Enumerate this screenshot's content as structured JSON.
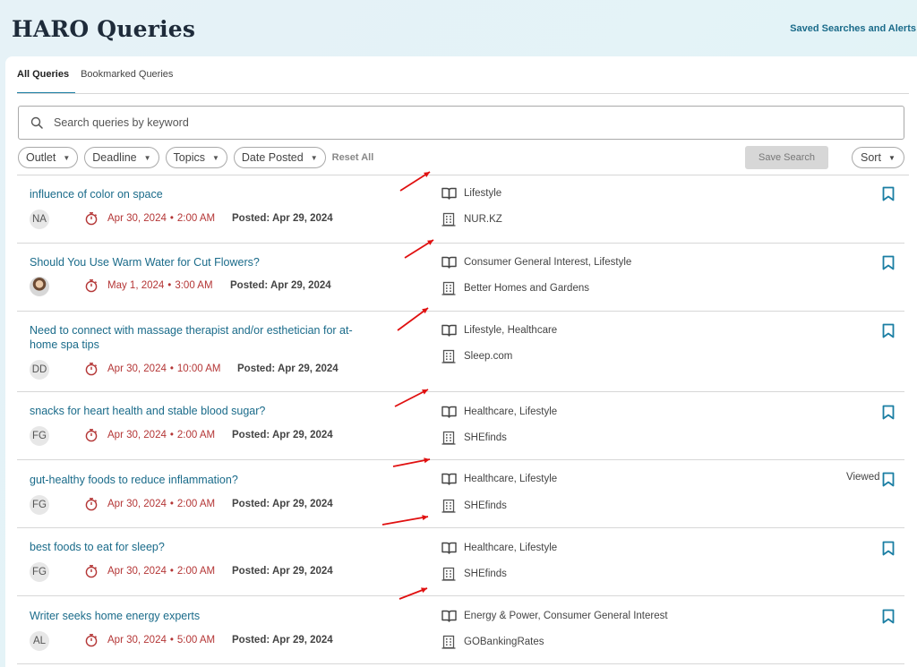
{
  "header": {
    "title": "HARO Queries",
    "saved_link": "Saved Searches and Alerts"
  },
  "tabs": [
    {
      "label": "All Queries",
      "active": true
    },
    {
      "label": "Bookmarked Queries",
      "active": false
    }
  ],
  "search": {
    "placeholder": "Search queries by keyword"
  },
  "filters": {
    "items": [
      {
        "label": "Outlet"
      },
      {
        "label": "Deadline"
      },
      {
        "label": "Topics"
      },
      {
        "label": "Date Posted"
      }
    ],
    "reset_label": "Reset All",
    "save_search_label": "Save Search",
    "sort_label": "Sort"
  },
  "colors": {
    "accent": "#1a6b8a",
    "deadline": "#b43636",
    "annotation_arrow": "#e01010"
  },
  "queries": [
    {
      "title": "influence of color on space",
      "initials": "NA",
      "deadline_date": "Apr 30, 2024",
      "deadline_time": "2:00 AM",
      "posted": "Posted: Apr 29, 2024",
      "topics": "Lifestyle",
      "outlet": "NUR.KZ",
      "viewed": ""
    },
    {
      "title": "Should You Use Warm Water for Cut Flowers?",
      "initials": "",
      "deadline_date": "May 1, 2024",
      "deadline_time": "3:00 AM",
      "posted": "Posted: Apr 29, 2024",
      "topics": "Consumer General Interest, Lifestyle",
      "outlet": "Better Homes and Gardens",
      "viewed": ""
    },
    {
      "title": "Need to connect with massage therapist and/or esthetician for at-home spa tips",
      "initials": "DD",
      "deadline_date": "Apr 30, 2024",
      "deadline_time": "10:00 AM",
      "posted": "Posted: Apr 29, 2024",
      "topics": "Lifestyle, Healthcare",
      "outlet": "Sleep.com",
      "viewed": ""
    },
    {
      "title": "snacks for heart health and stable blood sugar?",
      "initials": "FG",
      "deadline_date": "Apr 30, 2024",
      "deadline_time": "2:00 AM",
      "posted": "Posted: Apr 29, 2024",
      "topics": "Healthcare, Lifestyle",
      "outlet": "SHEfinds",
      "viewed": ""
    },
    {
      "title": "gut-healthy foods to reduce inflammation?",
      "initials": "FG",
      "deadline_date": "Apr 30, 2024",
      "deadline_time": "2:00 AM",
      "posted": "Posted: Apr 29, 2024",
      "topics": "Healthcare, Lifestyle",
      "outlet": "SHEfinds",
      "viewed": "Viewed"
    },
    {
      "title": "best foods to eat for sleep?",
      "initials": "FG",
      "deadline_date": "Apr 30, 2024",
      "deadline_time": "2:00 AM",
      "posted": "Posted: Apr 29, 2024",
      "topics": "Healthcare, Lifestyle",
      "outlet": "SHEfinds",
      "viewed": ""
    },
    {
      "title": "Writer seeks home energy experts",
      "initials": "AL",
      "deadline_date": "Apr 30, 2024",
      "deadline_time": "5:00 AM",
      "posted": "Posted: Apr 29, 2024",
      "topics": "Energy & Power, Consumer General Interest",
      "outlet": "GOBankingRates",
      "viewed": ""
    }
  ]
}
